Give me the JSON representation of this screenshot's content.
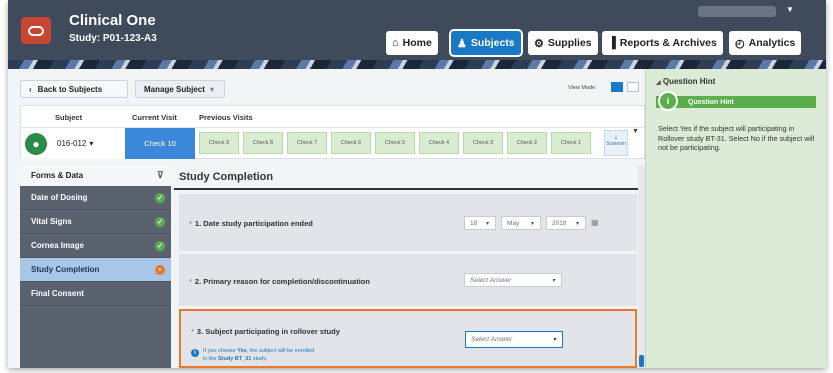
{
  "header": {
    "app_title": "Clinical One",
    "study_line": "Study: P01-123-A3",
    "nav": [
      {
        "label": "Home",
        "icon": "home-icon",
        "glyph": "⌂"
      },
      {
        "label": "Subjects",
        "icon": "subjects-icon",
        "glyph": "♟"
      },
      {
        "label": "Supplies",
        "icon": "supplies-icon",
        "glyph": "⚙"
      },
      {
        "label": "Reports & Archives",
        "icon": "reports-icon",
        "glyph": "▐"
      },
      {
        "label": "Analytics",
        "icon": "analytics-icon",
        "glyph": "◴"
      }
    ],
    "active_nav": "Subjects",
    "accent": "#1a79c6",
    "brand": "#c74634"
  },
  "toolbar": {
    "back_label": "Back to Subjects",
    "manage_label": "Manage Subject",
    "view_mode_label": "View Mode:"
  },
  "visits": {
    "subject_header": "Subject",
    "current_header": "Current Visit",
    "previous_header": "Previous Visits",
    "subject_id": "016-012",
    "current_visit": "Check 10",
    "previous": [
      "Check 9",
      "Check 8",
      "Check 7",
      "Check 6",
      "Check 5",
      "Check 4",
      "Check 3",
      "Check 2",
      "Check 1"
    ],
    "screening": "Screenin"
  },
  "forms": {
    "header": "Forms & Data",
    "items": [
      {
        "label": "Date of Dosing",
        "status": "complete"
      },
      {
        "label": "Vital Signs",
        "status": "complete"
      },
      {
        "label": "Cornea Image",
        "status": "complete"
      },
      {
        "label": "Study Completion",
        "status": "in-progress"
      },
      {
        "label": "Final Consent",
        "status": ""
      }
    ],
    "selected": "Study Completion"
  },
  "form": {
    "title": "Study Completion",
    "q1": {
      "label": "1. Date study participation ended",
      "day": "18",
      "month": "May",
      "year": "2018"
    },
    "q2": {
      "label": "2. Primary reason for completion/discontinuation",
      "placeholder": "Select Answer"
    },
    "q3": {
      "label": "3. Subject participating in rollover study",
      "placeholder": "Select Answer",
      "info_1": "If you choose ",
      "info_yes": "Yes",
      "info_2": ", the subject will be enrolled",
      "info_3": "in the ",
      "info_study": "Study BT_31",
      "info_4": " study."
    }
  },
  "hint": {
    "panel_title": "Question Hint",
    "bar_title": "Question Hint",
    "text": "Select Yes if the subject will participating in Rollover study BT-31. Select No if the subject will not be participating."
  }
}
